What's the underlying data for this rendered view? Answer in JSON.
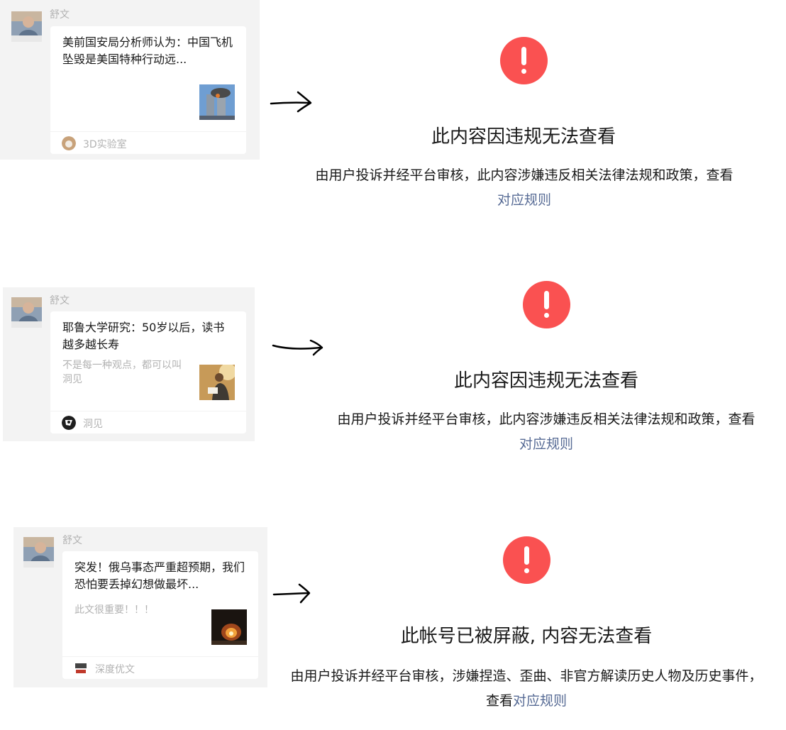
{
  "messages": [
    {
      "sender": "舒文",
      "card_title": "美前国安局分析师认为：中国飞机坠毁是美国特种行动远...",
      "card_desc": "",
      "source_name": "3D实验室"
    },
    {
      "sender": "舒文",
      "card_title": "耶鲁大学研究：50岁以后，读书越多越长寿",
      "card_desc": "不是每一种观点，都可以叫洞见",
      "source_name": "洞见"
    },
    {
      "sender": "舒文",
      "card_title": "突发！俄乌事态严重超预期，我们恐怕要丢掉幻想做最坏...",
      "card_desc": "此文很重要！！！",
      "source_name": "深度优文"
    }
  ],
  "notices": [
    {
      "icon": "warning-icon",
      "title": "此内容因违规无法查看",
      "desc_text": "由用户投诉并经平台审核，此内容涉嫌违反相关法律法规和政策，查看",
      "link_text": "对应规则"
    },
    {
      "icon": "warning-icon",
      "title": "此内容因违规无法查看",
      "desc_text": "由用户投诉并经平台审核，此内容涉嫌违反相关法律法规和政策，查看",
      "link_text": "对应规则"
    },
    {
      "icon": "warning-icon",
      "title": "此帐号已被屏蔽, 内容无法查看",
      "desc_text": "由用户投诉并经平台审核，涉嫌捏造、歪曲、非官方解读历史人物及历史事件，查看",
      "link_text": "对应规则"
    }
  ],
  "colors": {
    "panel_bg": "#f3f3f3",
    "warning_red": "#fa5151",
    "link_blue": "#576b95",
    "muted_text": "#b2b2b2"
  }
}
